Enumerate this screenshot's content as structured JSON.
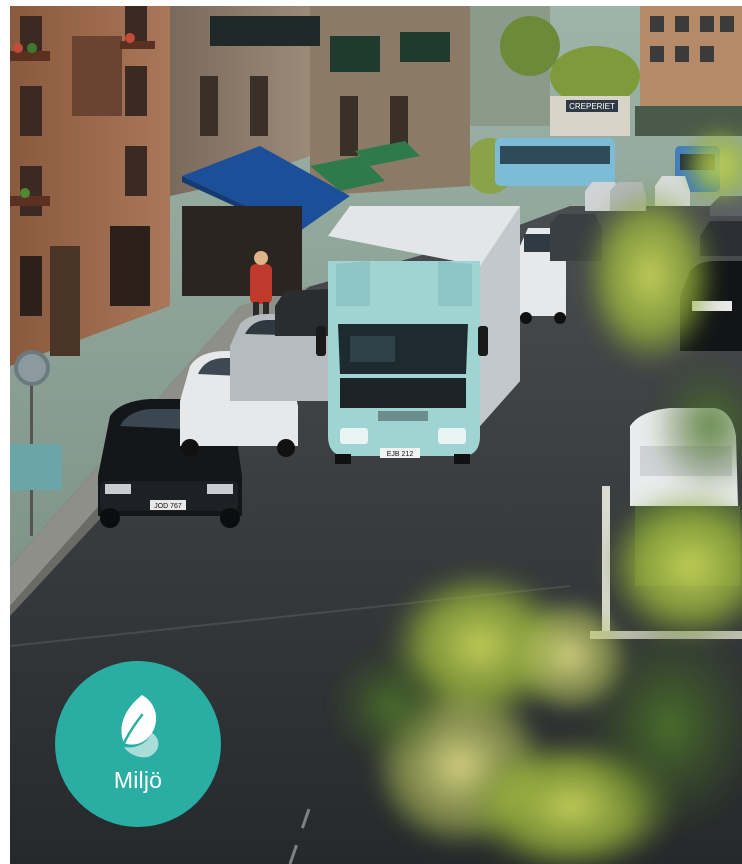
{
  "badge": {
    "label": "Miljö",
    "icon": "leaf-icon",
    "color": "#2aaea3"
  },
  "photo": {
    "truck_plate": "EJB 212",
    "car_plate": "JOD 767",
    "shop_sign": "CREPERIET"
  }
}
